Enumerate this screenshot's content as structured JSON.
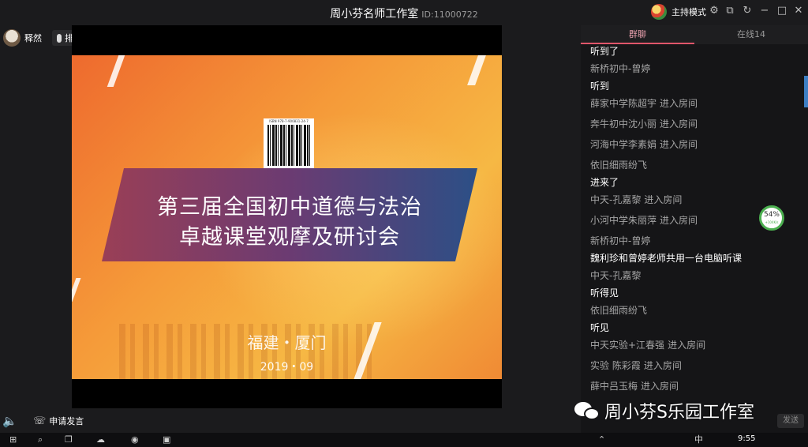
{
  "window": {
    "title": "周小芬名师工作室",
    "room_id": "ID:11000722",
    "host_mode_label": "主持模式"
  },
  "top_left": {
    "user_name": "释然",
    "queue_label": "排麦"
  },
  "slide": {
    "barcode_text": "ISBN 978-7-900831-24-7",
    "title_line1": "第三届全国初中道德与法治",
    "title_line2": "卓越课堂观摩及研讨会",
    "location": "福建・厦门",
    "date": "2019・09"
  },
  "bottom_controls": {
    "apply_label": "申请发言"
  },
  "panel": {
    "tabs": [
      "群聊",
      "在线14"
    ],
    "messages": [
      {
        "kind": "text",
        "text": "听到了"
      },
      {
        "kind": "chat",
        "sender": "新桥初中-曾婷",
        "text": "听到"
      },
      {
        "kind": "sys",
        "sender": "薛家中学陈超宇",
        "action": "进入房间"
      },
      {
        "kind": "sys",
        "sender": "奔牛初中沈小丽",
        "action": "进入房间"
      },
      {
        "kind": "sys",
        "sender": "河海中学李素娟",
        "action": "进入房间"
      },
      {
        "kind": "chat",
        "sender": "依旧细雨纷飞",
        "text": "进来了"
      },
      {
        "kind": "sys",
        "sender": "中天-孔嘉黎",
        "action": "进入房间"
      },
      {
        "kind": "sys",
        "sender": "小河中学朱丽萍",
        "action": "进入房间"
      },
      {
        "kind": "chat",
        "sender": "新桥初中-曾婷",
        "text": "魏利珍和曾婷老师共用一台电脑听课"
      },
      {
        "kind": "chat",
        "sender": "中天-孔嘉黎",
        "text": "听得见"
      },
      {
        "kind": "chat",
        "sender": "依旧细雨纷飞",
        "text": "听见"
      },
      {
        "kind": "sys",
        "sender": "中天实验+江春强",
        "action": "进入房间"
      },
      {
        "kind": "sys",
        "sender": "实验 陈彩霞",
        "action": "进入房间"
      },
      {
        "kind": "sys",
        "sender": "薛中吕玉梅",
        "action": "进入房间"
      }
    ],
    "send_label": "发送"
  },
  "speed_widget": {
    "percent": "54%",
    "rate": "+104K/s"
  },
  "watermark": "周小芬S乐园工作室",
  "taskbar": {
    "time": "9:55",
    "ime": "中"
  },
  "colors": {
    "accent_pink": "#e0566a",
    "speed_green": "#4caf50",
    "slide_orange": "#f59a39"
  }
}
